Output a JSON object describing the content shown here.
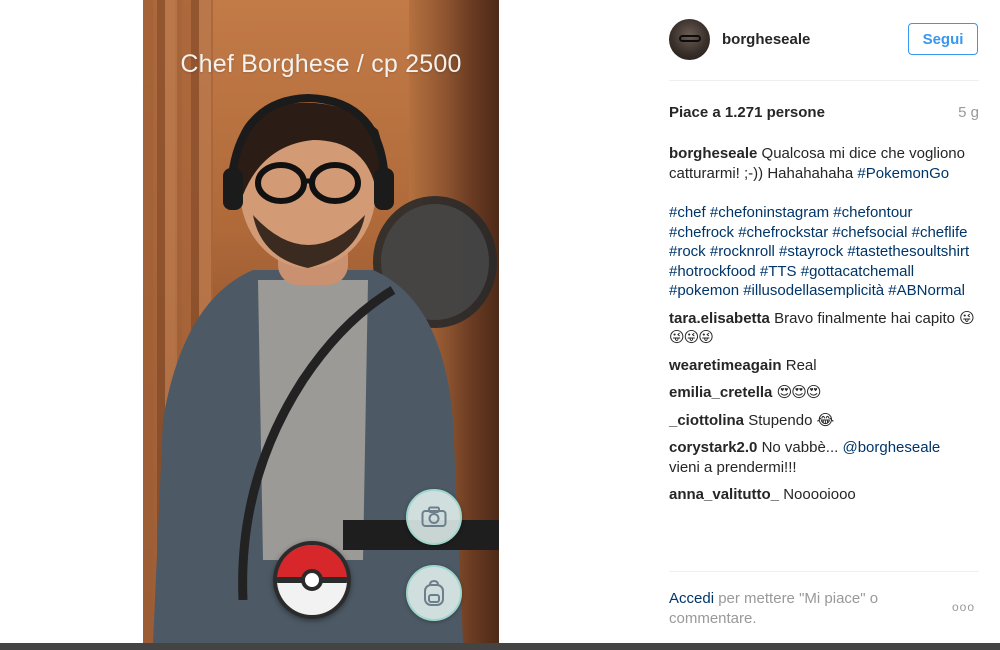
{
  "post": {
    "overlay_title": "Chef Borghese / cp 2500",
    "username": "borgheseale",
    "follow_label": "Segui",
    "likes_text": "Piace a 1.271 persone",
    "time_ago": "5 g",
    "caption": {
      "username": "borgheseale",
      "text": "Qualcosa mi dice che vogliono catturarmi! ;-)) Hahahahaha",
      "inline_hashtag": "#PokemonGo",
      "hashtags": "#chef #chefoninstagram #chefontour #chefrock #chefrockstar #chefsocial #cheflife #rock #rocknroll #stayrock #tastethesoultshirt #hotrockfood #TTS #gottacatchemall #pokemon #illusodellasemplicità #ABNormal"
    },
    "comments": [
      {
        "username": "tara.elisabetta",
        "text": "Bravo finalmente hai capito",
        "emoji": "😜😜😜😜"
      },
      {
        "username": "wearetimeagain",
        "text": "Real",
        "emoji": ""
      },
      {
        "username": "emilia_cretella",
        "text": "",
        "emoji": "😍😍😍"
      },
      {
        "username": "_ciottolina",
        "text": "Stupendo",
        "emoji": "😂"
      },
      {
        "username": "corystark2.0",
        "text": "No vabbè...",
        "mention": "@borgheseale",
        "text_after": "vieni a prendermi!!!"
      },
      {
        "username": "anna_valitutto_",
        "text": "Nooooiooo",
        "emoji": ""
      }
    ],
    "login_link": "Accedi",
    "login_suffix": "per mettere \"Mi piace\" o commentare.",
    "more_label": "ooo"
  },
  "icons": {
    "camera": "camera-icon",
    "backpack": "backpack-icon",
    "pokeball": "pokeball-icon"
  },
  "colors": {
    "link_blue": "#003569",
    "follow_blue": "#3897f0",
    "muted": "#999999",
    "pokeball_red": "#d8272b"
  }
}
